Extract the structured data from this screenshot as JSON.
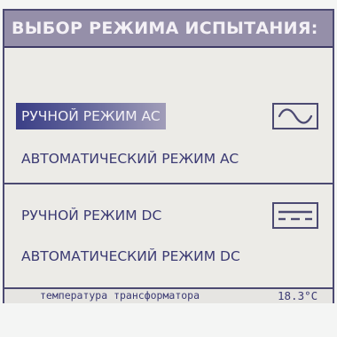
{
  "header": {
    "title": "ВЫБОР РЕЖИМА ИСПЫТАНИЯ:"
  },
  "ac_section": {
    "manual_label": "РУЧНОЙ РЕЖИМ AC",
    "auto_label": "АВТОМАТИЧЕСКИЙ РЕЖИМ AC",
    "icon": "sine-wave-icon"
  },
  "dc_section": {
    "manual_label": "РУЧНОЙ РЕЖИМ DC",
    "auto_label": "АВТОМАТИЧЕСКИЙ РЕЖИМ DC",
    "icon": "dc-symbol-icon"
  },
  "selected_item": "ac_manual",
  "status": {
    "label": "температура трансформатора",
    "value": "18.3°C"
  },
  "colors": {
    "header_bg": "#958fa9",
    "text": "#3b3a73",
    "border": "#4c4a72",
    "selection": "#3a3e86",
    "screen_bg": "#ecebe7"
  }
}
